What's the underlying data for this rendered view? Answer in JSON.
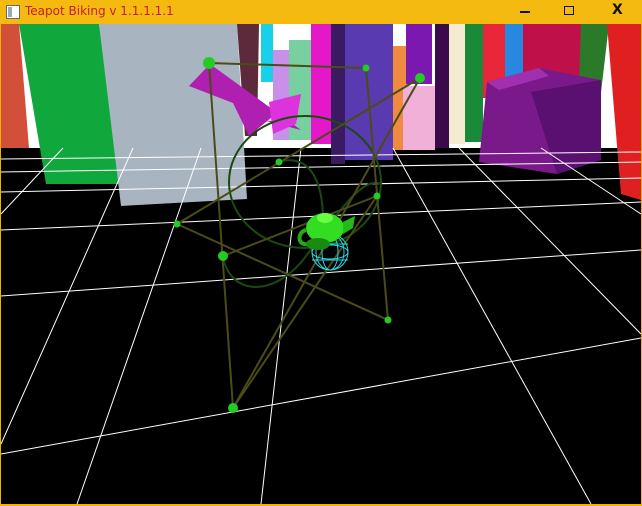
{
  "window": {
    "title": "Teapot Biking v 1.1.1.1.1",
    "controls": {
      "minimize": "minimize",
      "maximize": "maximize",
      "close": "X"
    }
  },
  "scene": {
    "sky_color": "#ffffff",
    "ground_color": "#000000",
    "grid_color": "#ffffff",
    "frame_line_color": "#4b4b18",
    "wheel_path_color": "#1a4a12",
    "joint_color": "#22cc22",
    "teapot_color": "#33dd22",
    "wireframe_ball_color": "#2bd6e0",
    "pedal_color": "#cc22cc",
    "buildings": [
      "red",
      "green",
      "gray",
      "cyan",
      "magenta",
      "indigo",
      "pink",
      "lime",
      "purple",
      "navy",
      "orange",
      "blue",
      "salmon"
    ]
  }
}
